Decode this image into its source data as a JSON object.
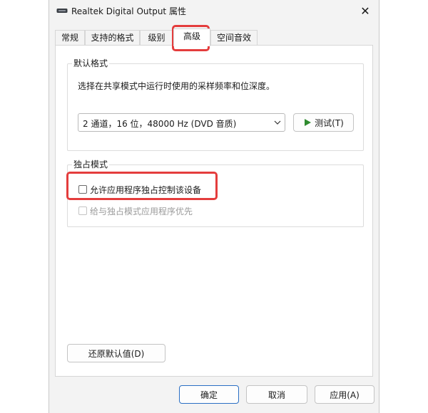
{
  "window": {
    "title": "Realtek Digital Output 属性",
    "icon": "speaker-icon",
    "close_glyph": "✕"
  },
  "tabs": [
    {
      "label": "常规",
      "active": false
    },
    {
      "label": "支持的格式",
      "active": false
    },
    {
      "label": "级别",
      "active": false
    },
    {
      "label": "高级",
      "active": true
    },
    {
      "label": "空间音效",
      "active": false
    }
  ],
  "default_format": {
    "title": "默认格式",
    "description": "选择在共享模式中运行时使用的采样频率和位深度。",
    "selected": "2 通道，16 位，48000 Hz (DVD 音质)",
    "test_label": "测试(T)",
    "test_icon": "play-icon"
  },
  "exclusive_mode": {
    "title": "独占模式",
    "allow_label": "允许应用程序独占控制该设备",
    "allow_checked": false,
    "priority_label": "给与独占模式应用程序优先",
    "priority_checked": false,
    "priority_enabled": false
  },
  "restore_defaults_label": "还原默认值(D)",
  "footer": {
    "ok": "确定",
    "cancel": "取消",
    "apply": "应用(A)"
  },
  "colors": {
    "highlight": "#e43d3d",
    "play": "#2e8b2e",
    "primary_border": "#2a6fc4"
  }
}
